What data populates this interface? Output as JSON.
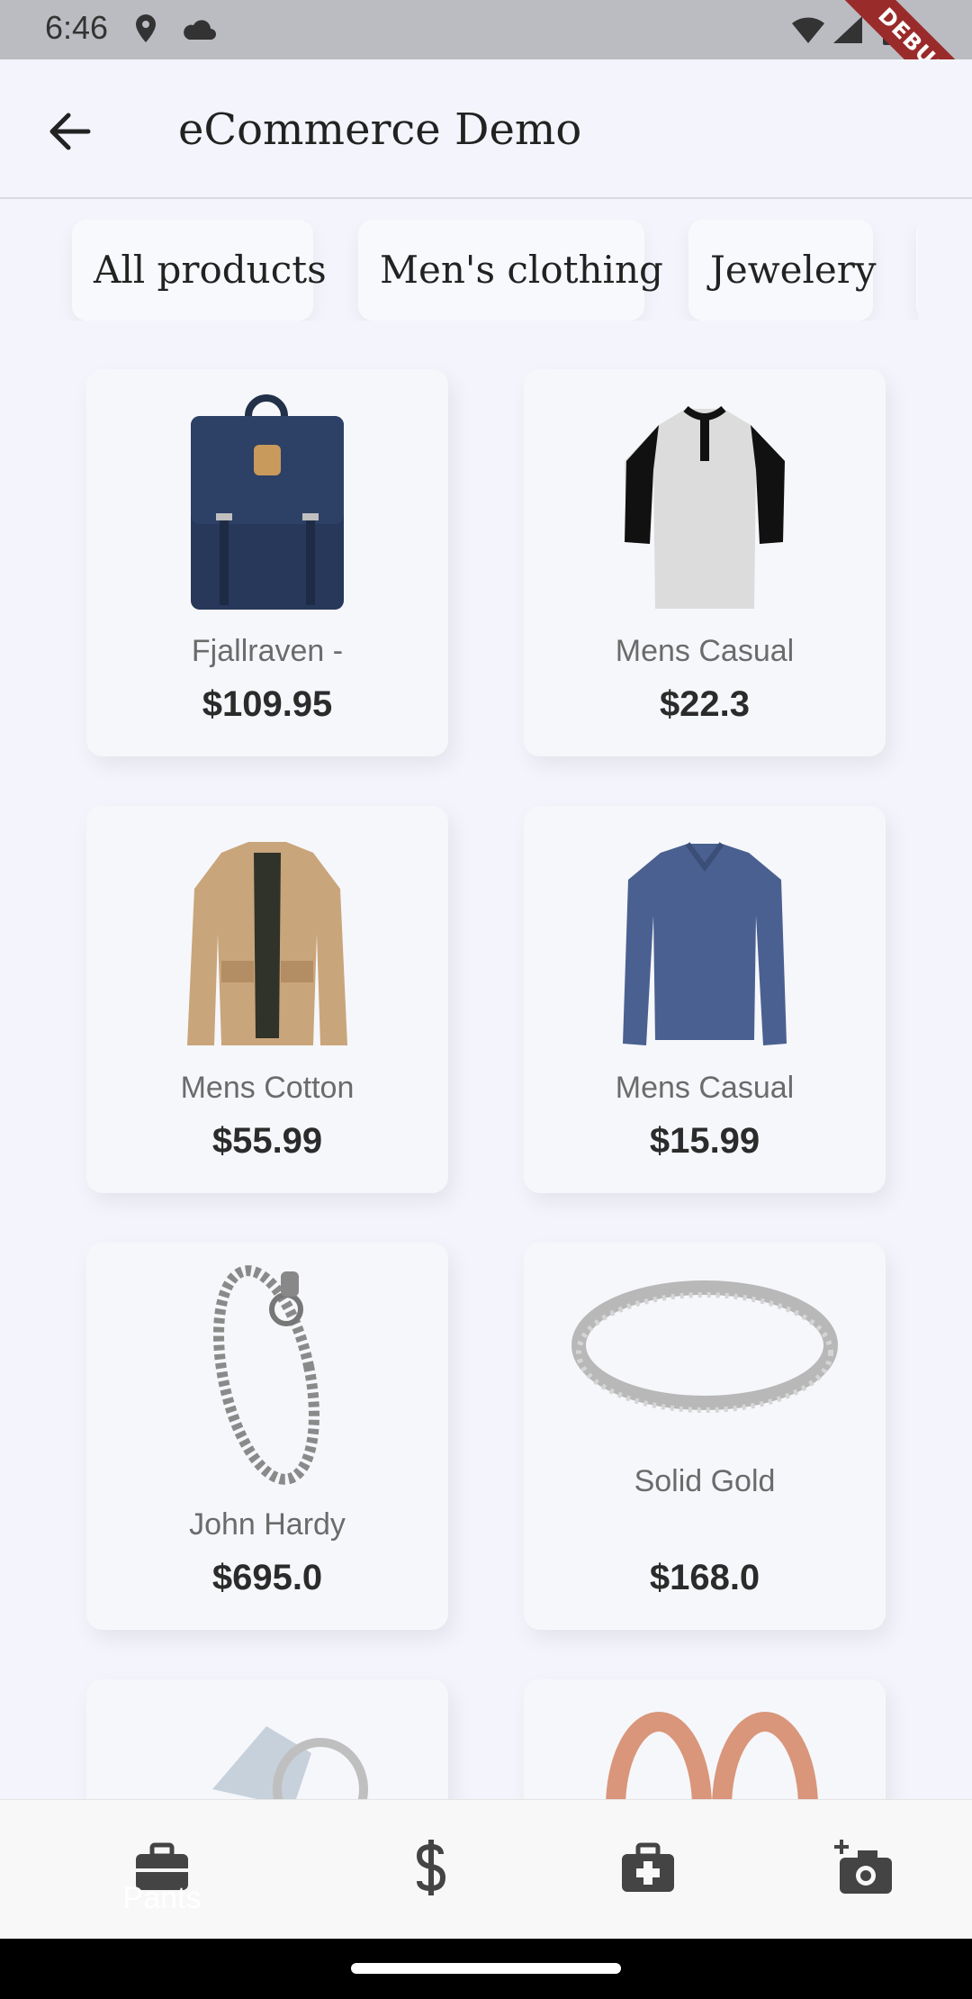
{
  "status_bar": {
    "time": "6:46",
    "debug_label": "DEBUG"
  },
  "app_bar": {
    "title": "eCommerce Demo"
  },
  "categories": [
    "All products",
    "Men's clothing",
    "Jewelery"
  ],
  "products": [
    {
      "name": "Fjallraven -",
      "price": "$109.95",
      "image": "backpack"
    },
    {
      "name": "Mens Casual",
      "price": "$22.3",
      "image": "henley-shirt"
    },
    {
      "name": "Mens Cotton",
      "price": "$55.99",
      "image": "jacket"
    },
    {
      "name": "Mens Casual",
      "price": "$15.99",
      "image": "long-sleeve-shirt"
    },
    {
      "name": "John Hardy",
      "price": "$695.0",
      "image": "bracelet"
    },
    {
      "name": "Solid Gold",
      "price": "$168.0",
      "image": "ring"
    }
  ],
  "bottom_nav": {
    "items": [
      "briefcase-icon",
      "dollar-icon",
      "medical-bag-icon",
      "add-photo-icon"
    ],
    "active_label": "Pants"
  },
  "colors": {
    "background": "#F4F5FC",
    "card": "#F6F7FB",
    "text": "#2B2B2B"
  }
}
